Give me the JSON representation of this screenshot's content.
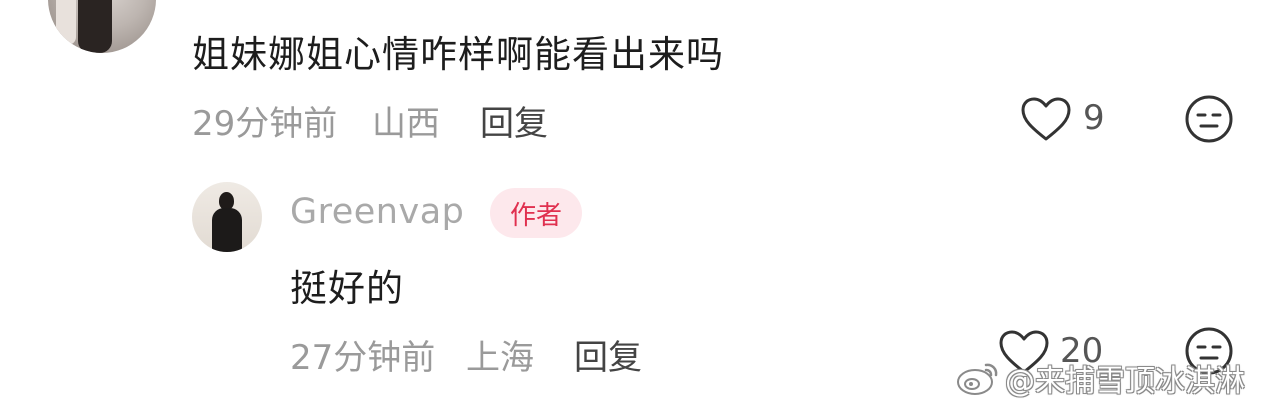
{
  "comment": {
    "text": "姐妹娜姐心情咋样啊能看出来吗",
    "time": "29分钟前",
    "location": "山西",
    "reply_label": "回复",
    "like_count": "9"
  },
  "reply": {
    "username": "Greenvap",
    "author_badge": "作者",
    "text": "挺好的",
    "time": "27分钟前",
    "location": "上海",
    "reply_label": "回复",
    "like_count": "20"
  },
  "watermark": {
    "text": "@来捕雪顶冰淇淋"
  },
  "icons": {
    "like": "heart-outline-icon",
    "react": "meh-face-icon",
    "weibo": "weibo-logo-icon"
  },
  "colors": {
    "badge_text": "#e0304f",
    "badge_bg": "#fde8ec",
    "meta_text": "#9a9a9a"
  }
}
